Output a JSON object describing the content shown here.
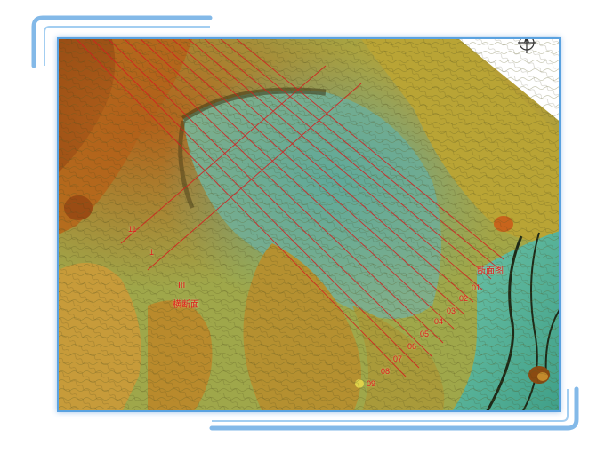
{
  "map": {
    "profile_numbers": [
      "01",
      "02",
      "03",
      "04",
      "05",
      "06",
      "07",
      "08",
      "09"
    ],
    "section_label_left_index": "III",
    "section_label_left": "横断面",
    "section_label_right": "断面图",
    "left_line_code_top": "11",
    "left_line_code_mid": "1",
    "compass_icon": "north-arrow-icon",
    "colors": {
      "frame_accent": "#5aa2e0",
      "profile_line": "#d42020",
      "terrain_high": "#b8781c",
      "terrain_mid": "#c6a93a",
      "terrain_low": "#6fb09a"
    }
  }
}
